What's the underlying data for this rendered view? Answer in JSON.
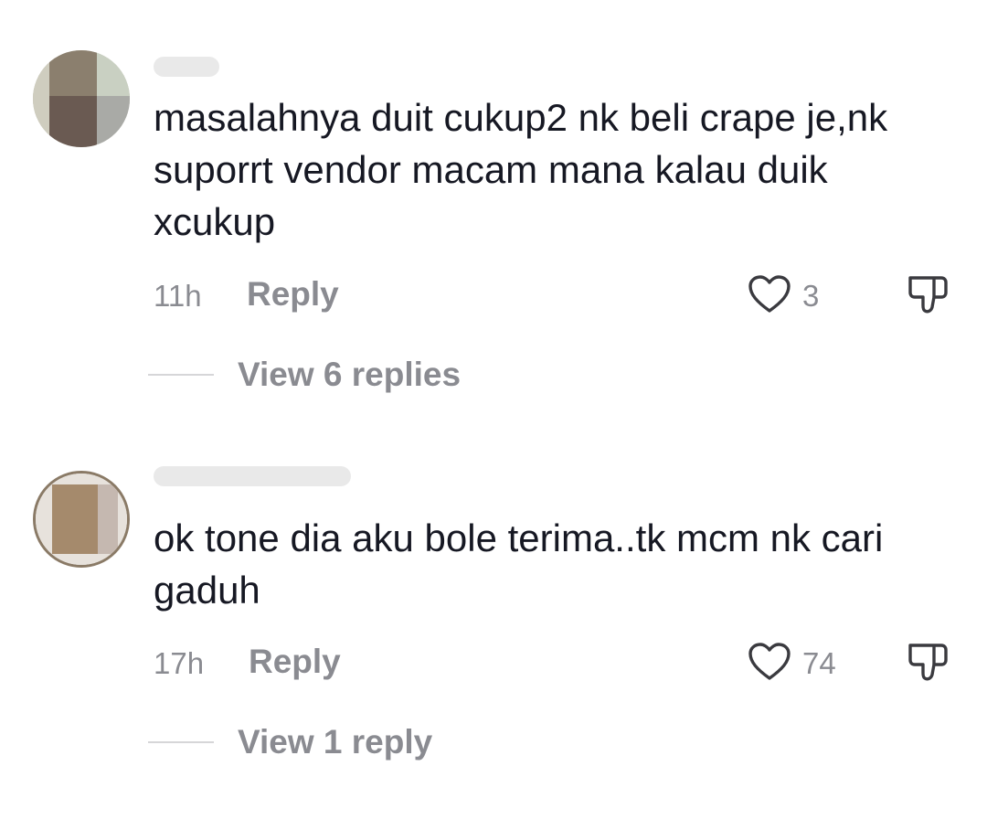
{
  "comments": [
    {
      "text": "masalahnya duit cukup2 nk beli crape je,nk suporrt vendor macam mana kalau duik xcukup",
      "time": "11h",
      "reply_label": "Reply",
      "likes": "3",
      "view_replies_label": "View 6 replies"
    },
    {
      "text": "ok tone dia aku bole terima..tk mcm nk cari gaduh",
      "time": "17h",
      "reply_label": "Reply",
      "likes": "74",
      "view_replies_label": "View 1 reply"
    }
  ],
  "colors": {
    "text": "#161823",
    "secondary": "#8a8b91",
    "divider": "#d6d6d8"
  },
  "icons": [
    "heart-icon",
    "dislike-icon"
  ]
}
